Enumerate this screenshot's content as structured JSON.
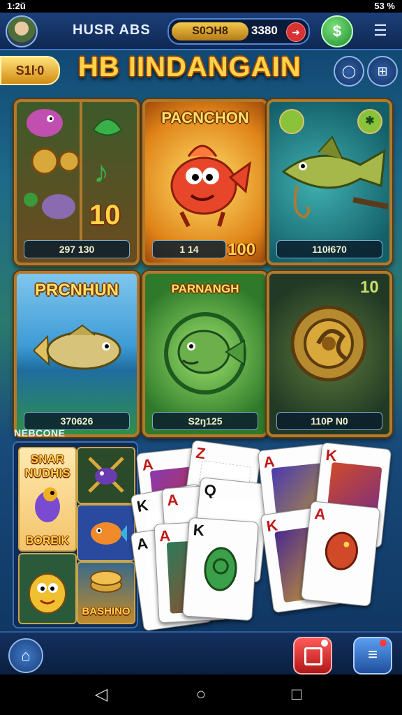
{
  "status_bar": {
    "time": "1:2ŭ",
    "right": "53 %"
  },
  "header": {
    "username": "HUSR ABS",
    "coin_label": "S0ƆH8",
    "balance": "3380"
  },
  "coin_pill": "S1ŀ0",
  "title": "HB IINDANGAIN",
  "games": [
    {
      "title": "",
      "label": "297 130",
      "badge": "10"
    },
    {
      "title": "PACNCHON",
      "label": "1 14",
      "badge": "100"
    },
    {
      "title": "",
      "label": "110ł670",
      "badge": ""
    },
    {
      "title": "PRCNHUN",
      "label": "370626",
      "badge": ""
    },
    {
      "title": "PARNANGH",
      "label": "S2ŋ125",
      "badge": ""
    },
    {
      "title": "",
      "label": "110P N0",
      "badge": "10"
    }
  ],
  "section_label": "NEBCONE",
  "mini_tiles": [
    {
      "text": "SNAR NUDHIS"
    },
    {
      "text": ""
    },
    {
      "text": "BOREIK"
    },
    {
      "text": ""
    },
    {
      "text": ""
    },
    {
      "text": "BASHINO"
    }
  ],
  "playing_cards": [
    {
      "rank": "A",
      "color": "red"
    },
    {
      "rank": "Z",
      "color": "red"
    },
    {
      "rank": "K",
      "color": "blk"
    },
    {
      "rank": "A",
      "color": "red"
    },
    {
      "rank": "Q",
      "color": "blk"
    },
    {
      "rank": "A",
      "color": "blk"
    },
    {
      "rank": "A",
      "color": "red"
    },
    {
      "rank": "K",
      "color": "blk"
    },
    {
      "rank": "A",
      "color": "red"
    },
    {
      "rank": "K",
      "color": "red"
    },
    {
      "rank": "K",
      "color": "red"
    },
    {
      "rank": "A",
      "color": "red"
    }
  ],
  "colors": {
    "accent_gold": "#ffd34a",
    "frame": "#b07a2d",
    "nav_bg": "#0f2854"
  }
}
